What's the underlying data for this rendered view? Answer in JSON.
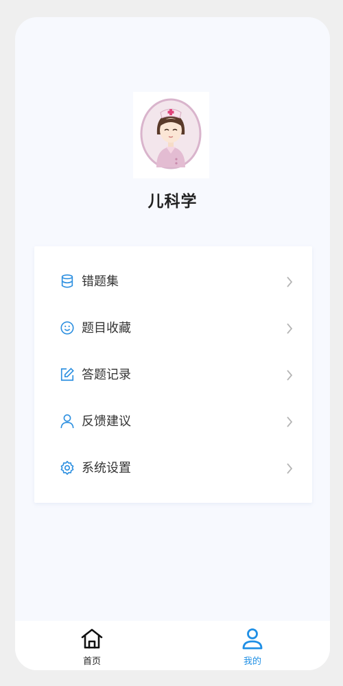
{
  "profile": {
    "subject_title": "儿科学"
  },
  "menu": {
    "items": [
      {
        "label": "错题集",
        "icon": "database-icon"
      },
      {
        "label": "题目收藏",
        "icon": "smile-icon"
      },
      {
        "label": "答题记录",
        "icon": "edit-icon"
      },
      {
        "label": "反馈建议",
        "icon": "user-icon"
      },
      {
        "label": "系统设置",
        "icon": "settings-icon"
      }
    ]
  },
  "tabbar": {
    "tabs": [
      {
        "label": "首页",
        "icon": "home-icon",
        "active": false
      },
      {
        "label": "我的",
        "icon": "user-icon",
        "active": true
      }
    ]
  },
  "colors": {
    "accent": "#1f8fe5",
    "icon_blue": "#2c8fe0",
    "text": "#333333",
    "chevron": "#b5b5b5",
    "background": "#f7f9fe"
  }
}
